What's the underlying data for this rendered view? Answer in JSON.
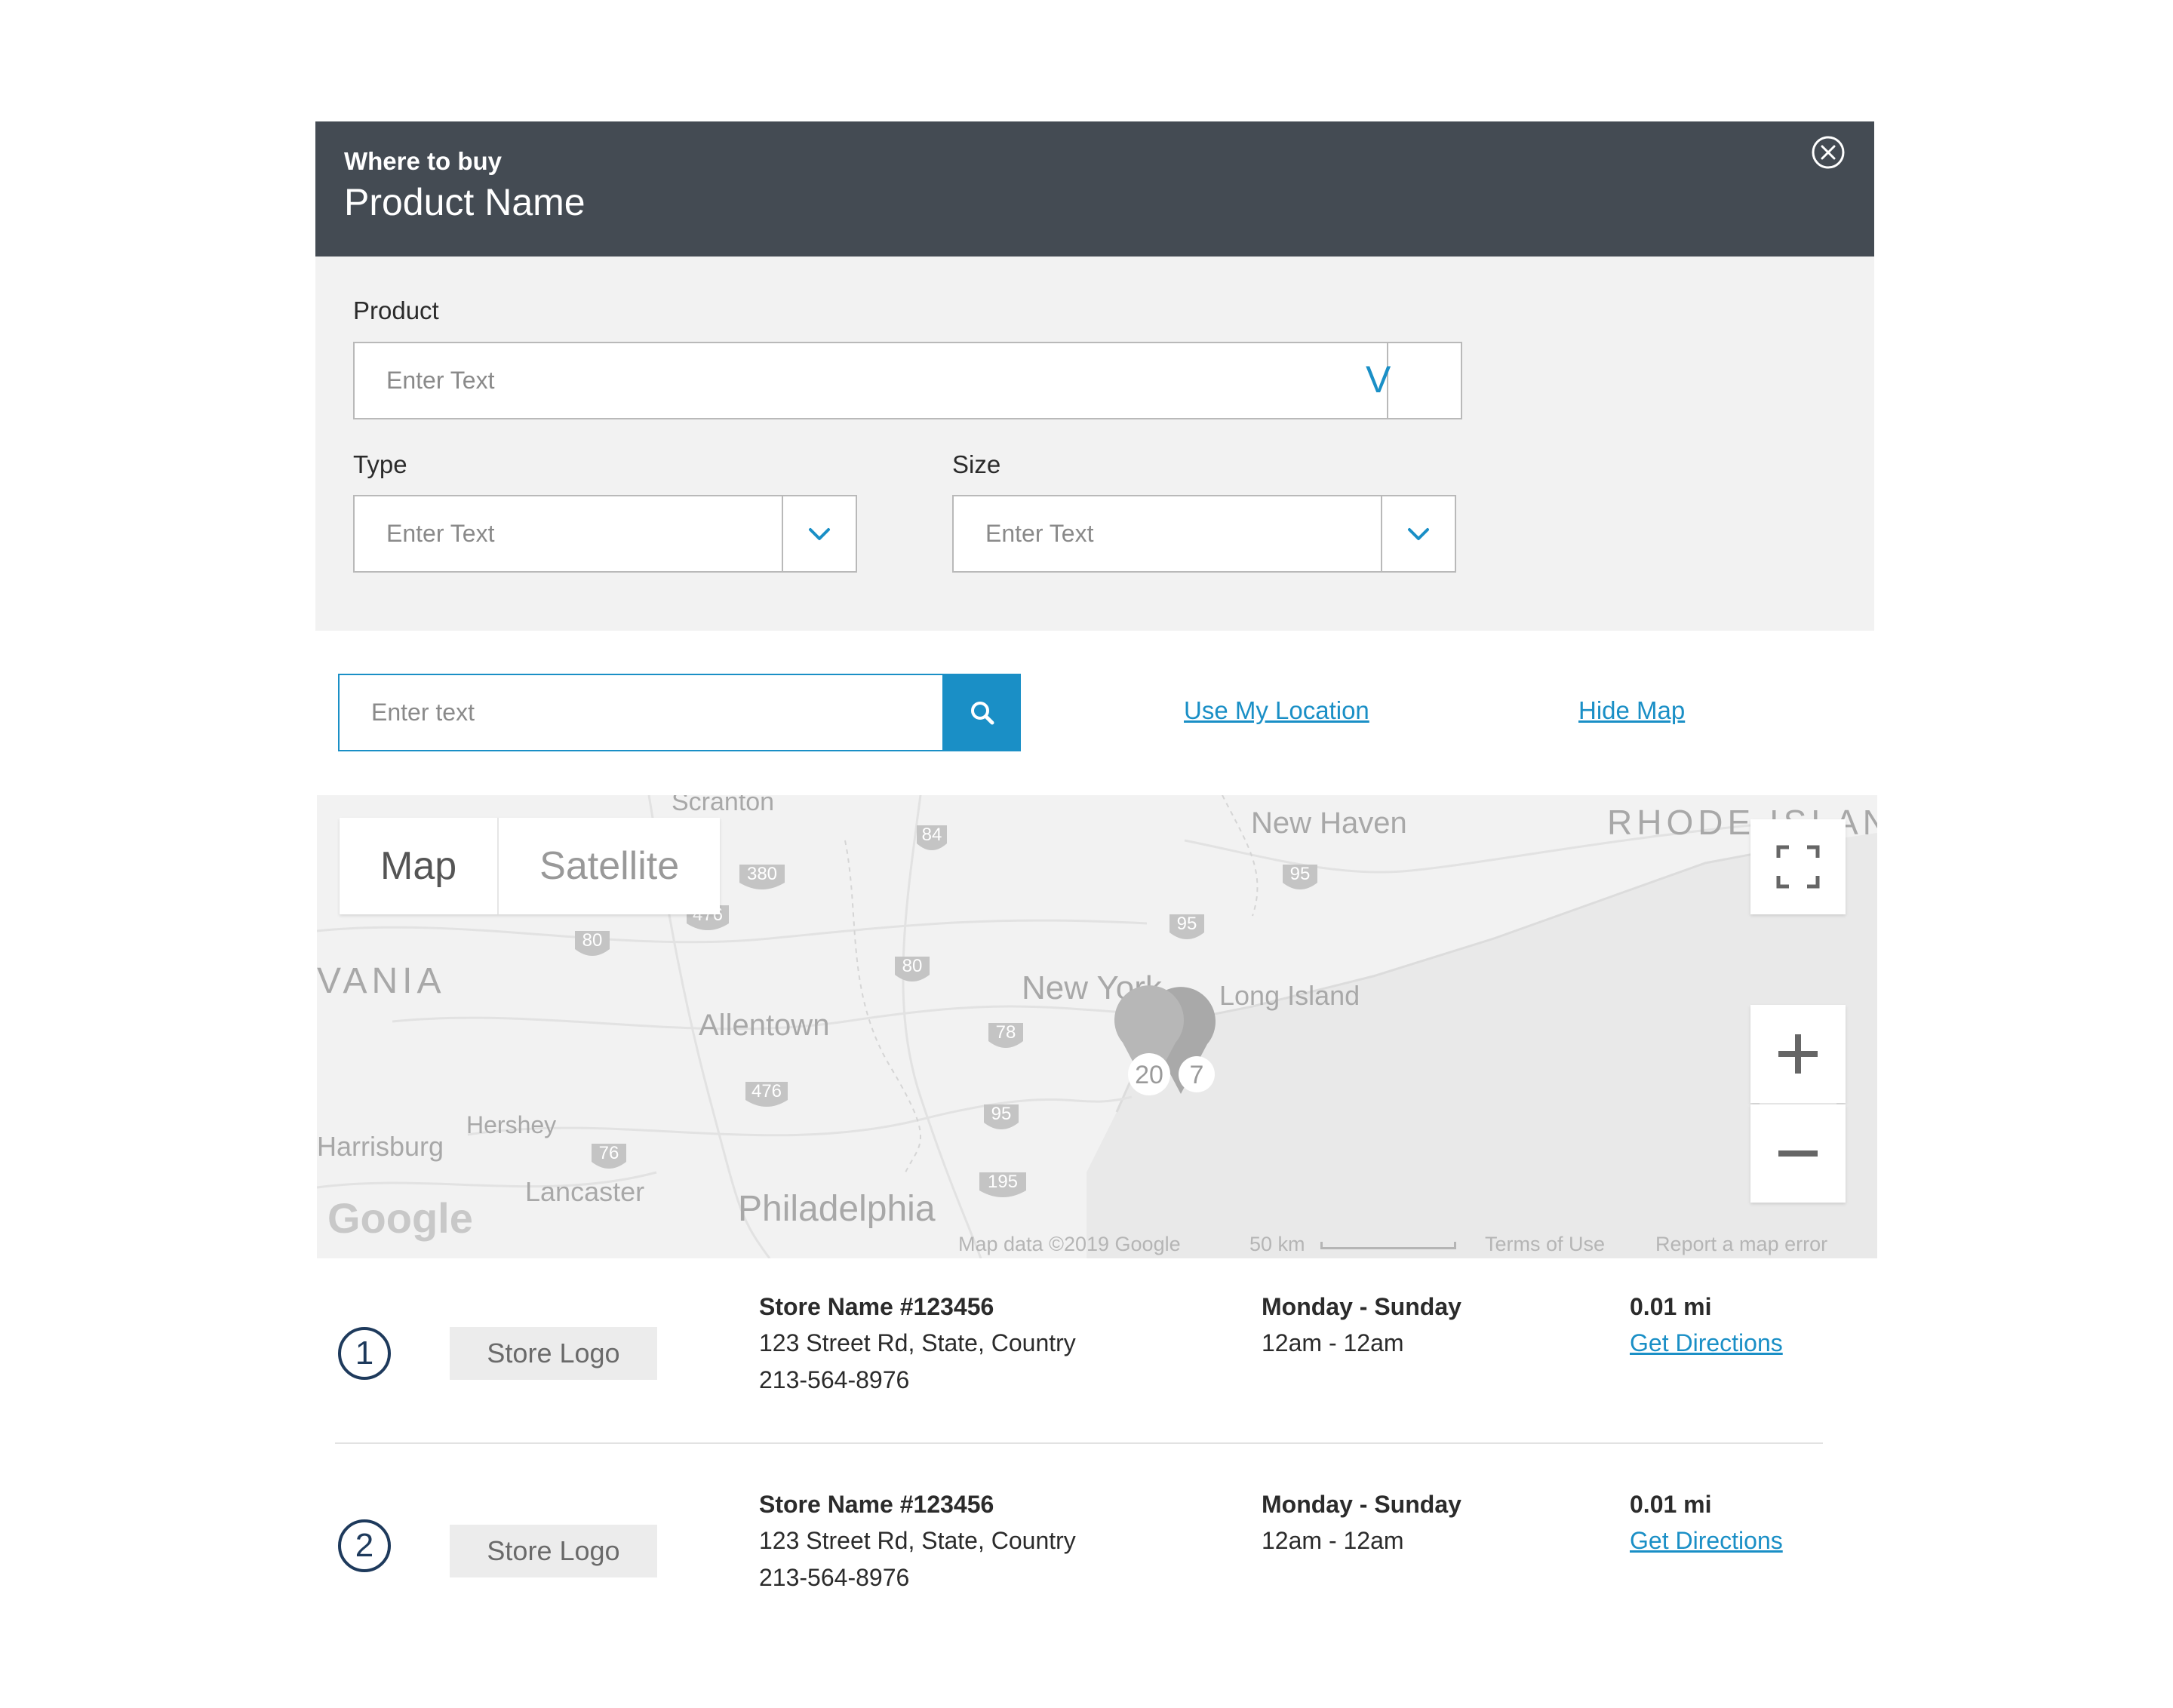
{
  "header": {
    "subtitle": "Where to buy",
    "title": "Product Name",
    "close_icon": "close-circle-icon"
  },
  "filters": {
    "product": {
      "label": "Product",
      "placeholder": "Enter Text",
      "arrow_glyph": "V"
    },
    "type": {
      "label": "Type",
      "placeholder": "Enter Text",
      "icon": "chevron-down-icon"
    },
    "size": {
      "label": "Size",
      "placeholder": "Enter Text",
      "icon": "chevron-down-icon"
    }
  },
  "search": {
    "placeholder": "Enter text",
    "icon": "search-icon",
    "use_location": "Use My Location",
    "hide_map": "Hide Map"
  },
  "map": {
    "type_options": [
      "Map",
      "Satellite"
    ],
    "selected_type": "Map",
    "place_labels": [
      "Scranton",
      "New Haven",
      "RHODE ISLAND",
      "VANIA",
      "New York",
      "Long Island",
      "Allentown",
      "Hershey",
      "Harrisburg",
      "Lancaster",
      "Philadelphia"
    ],
    "highway_shields": [
      "84",
      "380",
      "476",
      "80",
      "80",
      "95",
      "95",
      "78",
      "476",
      "95",
      "76",
      "195"
    ],
    "cluster_labels": [
      "20",
      "7"
    ],
    "logo": "Google",
    "attribution": "Map data ©2019 Google",
    "scale": "50 km",
    "terms": "Terms of Use",
    "report": "Report a map error",
    "controls": [
      "fullscreen-icon",
      "zoom-in-icon",
      "zoom-out-icon"
    ]
  },
  "stores": [
    {
      "number": "1",
      "logo": "Store Logo",
      "name": "Store Name #123456",
      "address": "123 Street Rd, State, Country",
      "phone": "213-564-8976",
      "days": "Monday - Sunday",
      "hours": "12am - 12am",
      "distance": "0.01 mi",
      "directions": "Get Directions"
    },
    {
      "number": "2",
      "logo": "Store Logo",
      "name": "Store Name #123456",
      "address": "123 Street Rd, State, Country",
      "phone": "213-564-8976",
      "days": "Monday - Sunday",
      "hours": "12am - 12am",
      "distance": "0.01 mi",
      "directions": "Get Directions"
    }
  ],
  "colors": {
    "header_bg": "#444b53",
    "filters_bg": "#f2f2f2",
    "accent": "#1a8fc6",
    "number_circle": "#1e3a5c"
  }
}
